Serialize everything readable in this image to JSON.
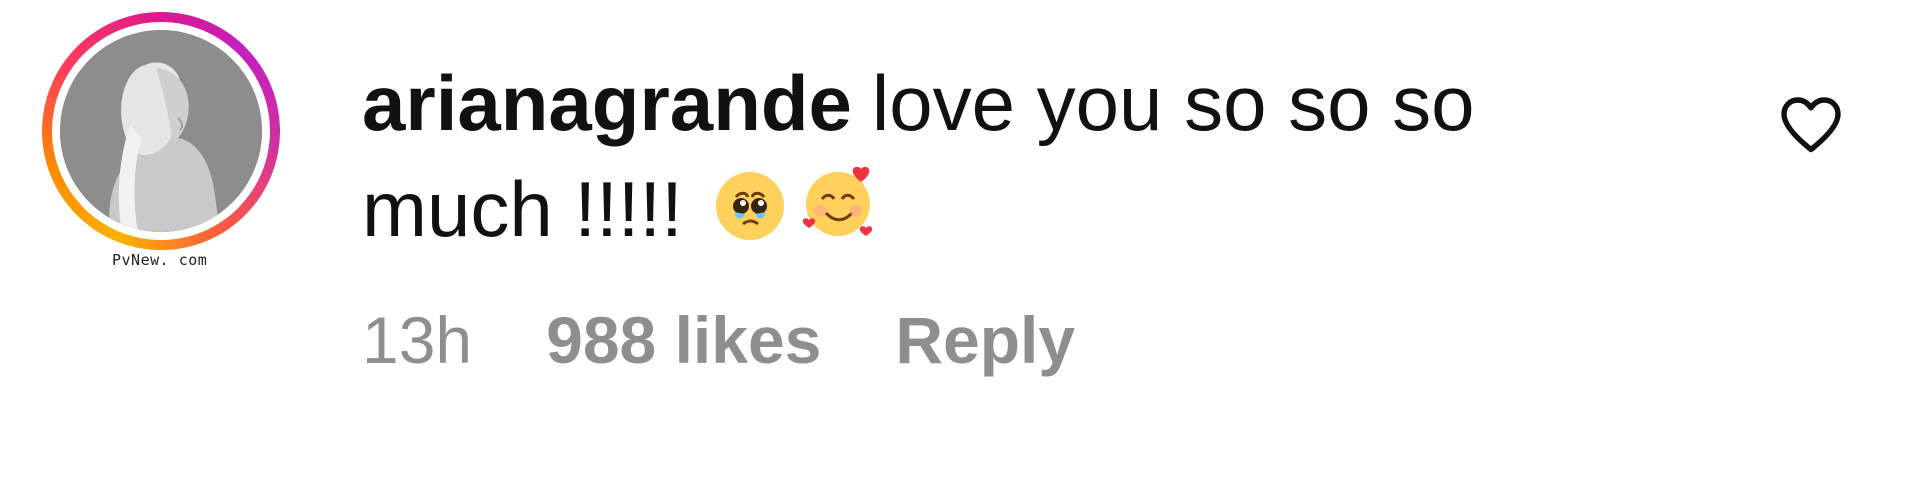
{
  "comment": {
    "username": "arianagrande",
    "text": "love you so so so much !!!!! ",
    "emojis": [
      "pleading-face-icon",
      "smiling-face-with-hearts-icon"
    ],
    "time": "13h",
    "likes": "988 likes",
    "reply_label": "Reply",
    "like_icon": "heart-outline-icon"
  },
  "watermark": "PvNew. com",
  "colors": {
    "text": "#111111",
    "meta": "#8e8e8e",
    "ring_start": "#ffb000",
    "ring_end": "#c21fbf"
  }
}
